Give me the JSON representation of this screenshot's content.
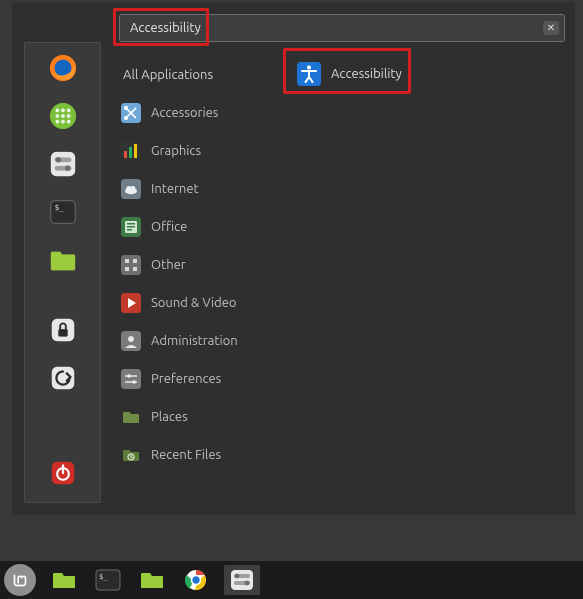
{
  "search": {
    "value": "Accessibility"
  },
  "categories": [
    {
      "key": "all",
      "label": "All Applications"
    },
    {
      "key": "accessories",
      "label": "Accessories"
    },
    {
      "key": "graphics",
      "label": "Graphics"
    },
    {
      "key": "internet",
      "label": "Internet"
    },
    {
      "key": "office",
      "label": "Office"
    },
    {
      "key": "other",
      "label": "Other"
    },
    {
      "key": "soundvideo",
      "label": "Sound & Video"
    },
    {
      "key": "admin",
      "label": "Administration"
    },
    {
      "key": "preferences",
      "label": "Preferences"
    },
    {
      "key": "places",
      "label": "Places"
    },
    {
      "key": "recent",
      "label": "Recent Files"
    }
  ],
  "results": [
    {
      "key": "accessibility",
      "label": "Accessibility"
    }
  ],
  "favorites": [
    {
      "key": "firefox"
    },
    {
      "key": "apps"
    },
    {
      "key": "settings"
    },
    {
      "key": "terminal"
    },
    {
      "key": "files"
    },
    {
      "key": "lock"
    },
    {
      "key": "logout"
    }
  ],
  "power": {
    "key": "power"
  },
  "taskbar": [
    {
      "key": "menu"
    },
    {
      "key": "show-desktop"
    },
    {
      "key": "terminal"
    },
    {
      "key": "files"
    },
    {
      "key": "chrome"
    },
    {
      "key": "settings"
    }
  ]
}
